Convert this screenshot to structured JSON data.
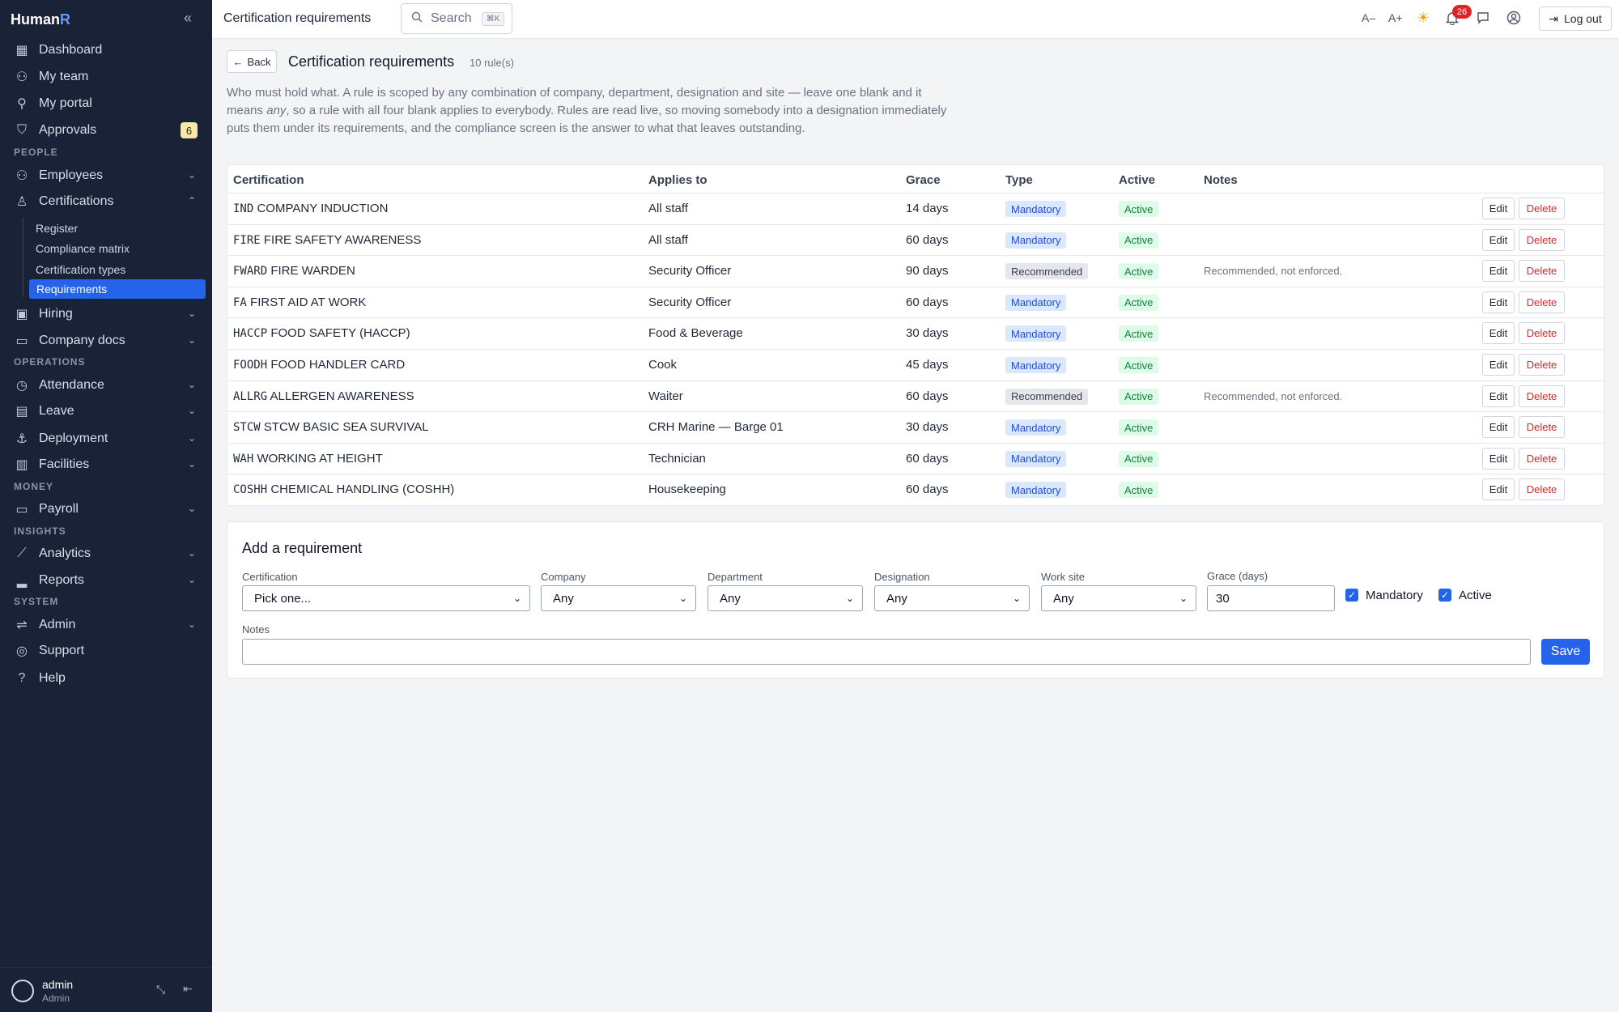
{
  "brand": {
    "name_main": "Human",
    "name_accent": "R"
  },
  "sidebar": {
    "items": [
      {
        "label": "Dashboard",
        "icon": "grid-icon"
      },
      {
        "label": "My team",
        "icon": "team-icon"
      },
      {
        "label": "My portal",
        "icon": "user-icon"
      },
      {
        "label": "Approvals",
        "icon": "shield-icon",
        "badge": "6"
      }
    ],
    "sections": [
      "PEOPLE",
      "OPERATIONS",
      "MONEY",
      "INSIGHTS",
      "SYSTEM"
    ],
    "people": [
      {
        "label": "Employees",
        "icon": "users-icon"
      },
      {
        "label": "Certifications",
        "icon": "award-icon"
      }
    ],
    "cert_sub": [
      "Register",
      "Compliance matrix",
      "Certification types",
      "Requirements"
    ],
    "people2": [
      {
        "label": "Hiring",
        "icon": "briefcase-icon"
      },
      {
        "label": "Company docs",
        "icon": "book-icon"
      }
    ],
    "operations": [
      {
        "label": "Attendance",
        "icon": "clock-icon"
      },
      {
        "label": "Leave",
        "icon": "calendar-icon"
      },
      {
        "label": "Deployment",
        "icon": "anchor-icon"
      },
      {
        "label": "Facilities",
        "icon": "building-icon"
      }
    ],
    "money": [
      {
        "label": "Payroll",
        "icon": "payroll-icon"
      }
    ],
    "insights": [
      {
        "label": "Analytics",
        "icon": "chart-line-icon"
      },
      {
        "label": "Reports",
        "icon": "bar-chart-icon"
      }
    ],
    "system": [
      {
        "label": "Admin",
        "icon": "sliders-icon"
      },
      {
        "label": "Support",
        "icon": "lifebuoy-icon"
      },
      {
        "label": "Help",
        "icon": "help-icon"
      }
    ],
    "user": {
      "name": "admin",
      "role": "Admin"
    }
  },
  "topbar": {
    "title": "Certification requirements",
    "search_placeholder": "Search",
    "search_kbd": "⌘K",
    "font_smaller": "A–",
    "font_larger": "A+",
    "notifications_count": "26",
    "logout_label": "Log out"
  },
  "page": {
    "back_label": "Back",
    "title": "Certification requirements",
    "count": "10 rule(s)",
    "intro_1": "Who must hold what. A rule is scoped by any combination of company, department, designation and site — leave one blank and it means ",
    "intro_em": "any",
    "intro_2": ", so a rule with all four blank applies to everybody. Rules are read live, so moving somebody into a designation immediately puts them under its requirements, and the compliance screen is the answer to what that leaves outstanding."
  },
  "table": {
    "headers": [
      "Certification",
      "Applies to",
      "Grace",
      "Type",
      "Active",
      "Notes"
    ],
    "edit_label": "Edit",
    "delete_label": "Delete",
    "rows": [
      {
        "code": "IND",
        "name": "COMPANY INDUCTION",
        "applies": "All staff",
        "grace": "14 days",
        "type": "Mandatory",
        "active": "Active",
        "notes": ""
      },
      {
        "code": "FIRE",
        "name": "FIRE SAFETY AWARENESS",
        "applies": "All staff",
        "grace": "60 days",
        "type": "Mandatory",
        "active": "Active",
        "notes": ""
      },
      {
        "code": "FWARD",
        "name": "FIRE WARDEN",
        "applies": "Security Officer",
        "grace": "90 days",
        "type": "Recommended",
        "active": "Active",
        "notes": "Recommended, not enforced."
      },
      {
        "code": "FA",
        "name": "FIRST AID AT WORK",
        "applies": "Security Officer",
        "grace": "60 days",
        "type": "Mandatory",
        "active": "Active",
        "notes": ""
      },
      {
        "code": "HACCP",
        "name": "FOOD SAFETY (HACCP)",
        "applies": "Food & Beverage",
        "grace": "30 days",
        "type": "Mandatory",
        "active": "Active",
        "notes": ""
      },
      {
        "code": "FOODH",
        "name": "FOOD HANDLER CARD",
        "applies": "Cook",
        "grace": "45 days",
        "type": "Mandatory",
        "active": "Active",
        "notes": ""
      },
      {
        "code": "ALLRG",
        "name": "ALLERGEN AWARENESS",
        "applies": "Waiter",
        "grace": "60 days",
        "type": "Recommended",
        "active": "Active",
        "notes": "Recommended, not enforced."
      },
      {
        "code": "STCW",
        "name": "STCW BASIC SEA SURVIVAL",
        "applies": "CRH Marine — Barge 01",
        "grace": "30 days",
        "type": "Mandatory",
        "active": "Active",
        "notes": ""
      },
      {
        "code": "WAH",
        "name": "WORKING AT HEIGHT",
        "applies": "Technician",
        "grace": "60 days",
        "type": "Mandatory",
        "active": "Active",
        "notes": ""
      },
      {
        "code": "COSHH",
        "name": "CHEMICAL HANDLING (COSHH)",
        "applies": "Housekeeping",
        "grace": "60 days",
        "type": "Mandatory",
        "active": "Active",
        "notes": ""
      }
    ]
  },
  "form": {
    "title": "Add a requirement",
    "certification_label": "Certification",
    "certification_value": "Pick one...",
    "company_label": "Company",
    "company_value": "Any",
    "department_label": "Department",
    "department_value": "Any",
    "designation_label": "Designation",
    "designation_value": "Any",
    "site_label": "Work site",
    "site_value": "Any",
    "grace_label": "Grace (days)",
    "grace_value": "30",
    "mandatory_label": "Mandatory",
    "mandatory_checked": true,
    "active_label": "Active",
    "active_checked": true,
    "notes_label": "Notes",
    "notes_value": "",
    "save_label": "Save"
  },
  "colors": {
    "sidebar_bg": "#1a2238",
    "accent": "#2563eb",
    "danger": "#dc2626",
    "mandatory_bg": "#dbe8fb",
    "active_bg": "#dcfce7"
  }
}
